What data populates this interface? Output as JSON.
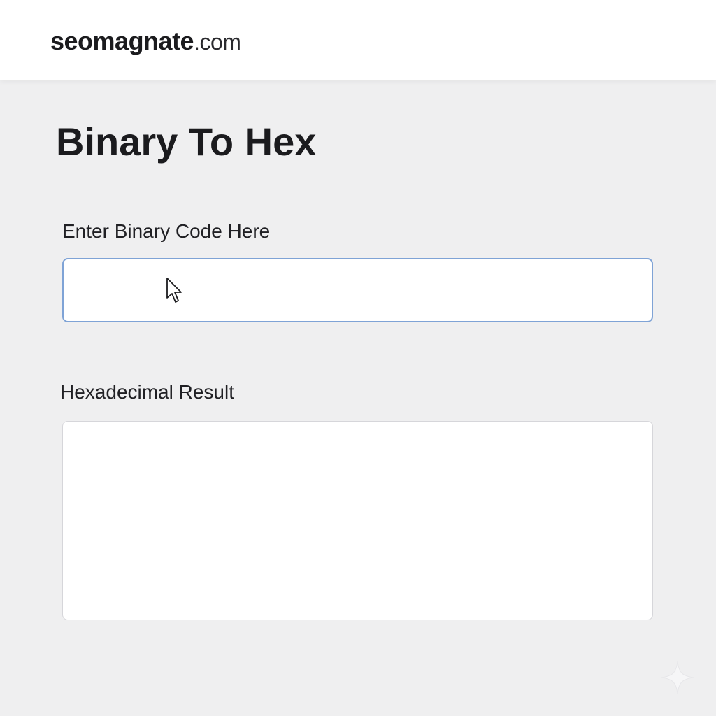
{
  "header": {
    "logo_name": "seomagnate",
    "logo_tld": ".com"
  },
  "page": {
    "title": "Binary To Hex"
  },
  "binary_input": {
    "label": "Enter Binary Code Here",
    "value": "",
    "placeholder": ""
  },
  "result": {
    "label": "Hexadecimal Result",
    "value": ""
  },
  "icons": {
    "cursor": "mouse-pointer-icon",
    "corner": "sparkle-icon"
  },
  "colors": {
    "input_focus_border": "#7fa3d6",
    "page_background": "#efeff0",
    "header_background": "#ffffff"
  }
}
